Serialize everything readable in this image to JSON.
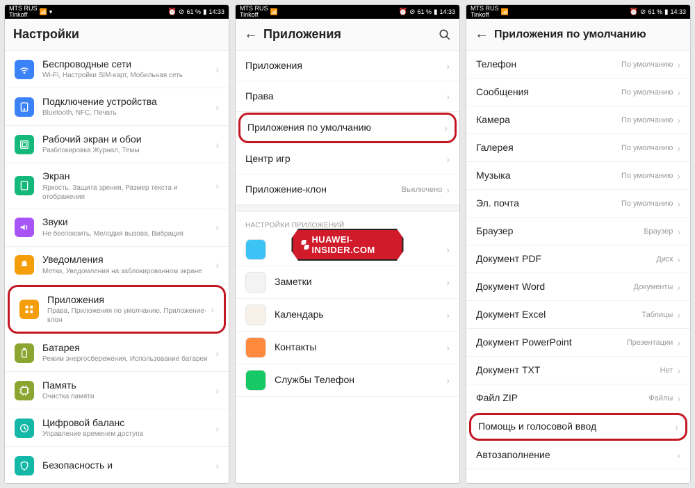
{
  "status": {
    "carrier_line1": "MTS RUS",
    "carrier_line2": "Tinkoff",
    "battery_pct": "61 %",
    "time": "14:33"
  },
  "watermark": "HUAWEI-INSIDER.COM",
  "screen1": {
    "title": "Настройки",
    "items": [
      {
        "icon": "wifi",
        "color": "#3b82f6",
        "title": "Беспроводные сети",
        "sub": "Wi-Fi, Настройки SIM-карт, Мобильная сеть"
      },
      {
        "icon": "device",
        "color": "#3b82f6",
        "title": "Подключение устройства",
        "sub": "Bluetooth, NFC, Печать"
      },
      {
        "icon": "home",
        "color": "#14b87a",
        "title": "Рабочий экран и обои",
        "sub": "Разблокировка Журнал, Темы"
      },
      {
        "icon": "display",
        "color": "#14b87a",
        "title": "Экран",
        "sub": "Яркость, Защита зрения, Размер текста и отображения"
      },
      {
        "icon": "sound",
        "color": "#a855f7",
        "title": "Звуки",
        "sub": "Не беспокоить, Мелодия вызова, Вибрация"
      },
      {
        "icon": "bell",
        "color": "#f59e0b",
        "title": "Уведомления",
        "sub": "Метки, Уведомления на заблокированном экране"
      },
      {
        "icon": "apps",
        "color": "#f59e0b",
        "title": "Приложения",
        "sub": "Права, Приложения по умолчанию, Приложение-клон",
        "highlight": true
      },
      {
        "icon": "battery",
        "color": "#8aa631",
        "title": "Батарея",
        "sub": "Режим энергосбережения, Использование батареи"
      },
      {
        "icon": "memory",
        "color": "#8aa631",
        "title": "Память",
        "sub": "Очистка памяти"
      },
      {
        "icon": "balance",
        "color": "#14b8a6",
        "title": "Цифровой баланс",
        "sub": "Управление временем доступа"
      },
      {
        "icon": "security",
        "color": "#14b8a6",
        "title": "Безопасность и",
        "sub": ""
      }
    ]
  },
  "screen2": {
    "title": "Приложения",
    "top": [
      {
        "title": "Приложения"
      },
      {
        "title": "Права"
      },
      {
        "title": "Приложения по умолчанию",
        "highlight": true
      },
      {
        "title": "Центр игр"
      },
      {
        "title": "Приложение-клон",
        "value": "Выключено"
      }
    ],
    "section_label": "НАСТРОЙКИ ПРИЛОЖЕНИЙ",
    "apps": [
      {
        "title": "",
        "color": "#3cc3f5"
      },
      {
        "title": "Заметки",
        "color": "#f3f3f3"
      },
      {
        "title": "Календарь",
        "color": "#f7f1ea"
      },
      {
        "title": "Контакты",
        "color": "#ff8a3d"
      },
      {
        "title": "Службы Телефон",
        "color": "#17c964"
      }
    ]
  },
  "screen3": {
    "title": "Приложения по умолчанию",
    "items": [
      {
        "title": "Телефон",
        "value": "По умолчанию"
      },
      {
        "title": "Сообщения",
        "value": "По умолчанию"
      },
      {
        "title": "Камера",
        "value": "По умолчанию"
      },
      {
        "title": "Галерея",
        "value": "По умолчанию"
      },
      {
        "title": "Музыка",
        "value": "По умолчанию"
      },
      {
        "title": "Эл. почта",
        "value": "По умолчанию"
      },
      {
        "title": "Браузер",
        "value": "Браузер"
      },
      {
        "title": "Документ PDF",
        "value": "Диск"
      },
      {
        "title": "Документ Word",
        "value": "Документы"
      },
      {
        "title": "Документ Excel",
        "value": "Таблицы"
      },
      {
        "title": "Документ PowerPoint",
        "value": "Презентации"
      },
      {
        "title": "Документ TXT",
        "value": "Нет"
      },
      {
        "title": "Файл ZIP",
        "value": "Файлы"
      },
      {
        "title": "Помощь и голосовой ввод",
        "value": "",
        "highlight": true
      },
      {
        "title": "Автозаполнение",
        "value": ""
      }
    ]
  }
}
